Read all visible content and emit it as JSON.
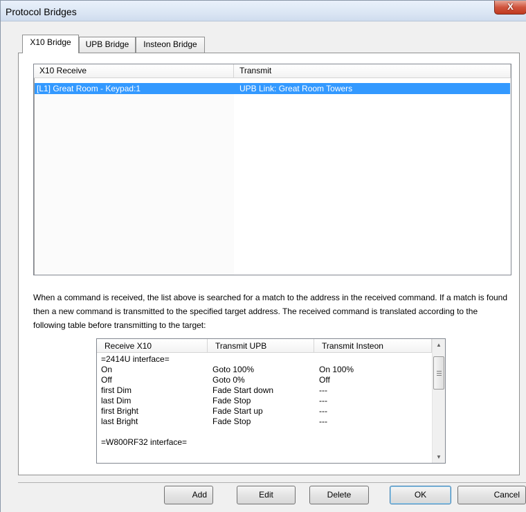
{
  "window": {
    "title": "Protocol Bridges",
    "close_glyph": "X"
  },
  "tabs": [
    {
      "label": "X10 Bridge",
      "active": true
    },
    {
      "label": "UPB Bridge",
      "active": false
    },
    {
      "label": "Insteon Bridge",
      "active": false
    }
  ],
  "bridge_list": {
    "columns": [
      "X10 Receive",
      "Transmit"
    ],
    "rows": [
      {
        "receive": "[L1] Great Room - Keypad:1",
        "transmit": "UPB Link: Great Room Towers",
        "selected": true
      }
    ]
  },
  "description": "When a command is received, the list above is searched for a match to the address in the received command.  If a match is found then a new command is transmitted to the specified target address.  The received command is translated according to the following table before transmitting to the target:",
  "translation_table": {
    "columns": [
      "Receive X10",
      "Transmit UPB",
      "Transmit Insteon"
    ],
    "rows": [
      {
        "c1": "=2414U interface=",
        "c2": "",
        "c3": ""
      },
      {
        "c1": "On",
        "c2": "Goto 100%",
        "c3": "On 100%"
      },
      {
        "c1": "Off",
        "c2": "Goto 0%",
        "c3": "Off"
      },
      {
        "c1": "first Dim",
        "c2": "Fade Start down",
        "c3": "---"
      },
      {
        "c1": "last Dim",
        "c2": "Fade Stop",
        "c3": "---"
      },
      {
        "c1": "first Bright",
        "c2": "Fade Start up",
        "c3": "---"
      },
      {
        "c1": "last Bright",
        "c2": "Fade Stop",
        "c3": "---"
      },
      {
        "c1": "",
        "c2": "",
        "c3": ""
      },
      {
        "c1": "=W800RF32 interface=",
        "c2": "",
        "c3": ""
      }
    ]
  },
  "buttons": {
    "add": "Add",
    "edit": "Edit",
    "delete": "Delete",
    "ok": "OK",
    "cancel": "Cancel"
  },
  "colors": {
    "selection": "#3399ff",
    "close_button": "#c94a2f"
  }
}
